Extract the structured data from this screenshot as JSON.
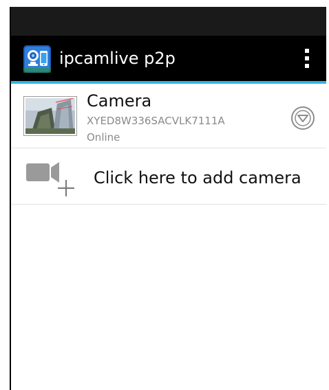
{
  "app": {
    "title": "ipcamlive p2p",
    "accent_color": "#33b5e5",
    "action_bar_color": "#000000",
    "status_bar_color": "#1a1a1a",
    "icons": {
      "app_icon": "ipcamlive-app-icon",
      "overflow": "overflow-menu-icon"
    }
  },
  "cameras": [
    {
      "name": "Camera",
      "id": "XYED8W336SACVLK7111A",
      "status": "Online",
      "icons": {
        "thumbnail": "camera-thumbnail",
        "menu": "chevron-down-circle-icon"
      }
    }
  ],
  "add_camera": {
    "label": "Click here to add camera",
    "icon": "add-video-camera-icon"
  }
}
